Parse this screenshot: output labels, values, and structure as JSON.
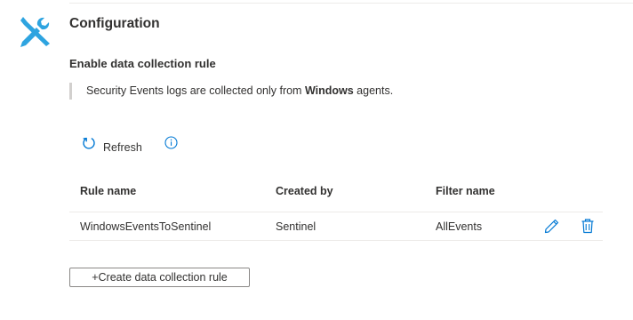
{
  "header": {
    "title": "Configuration",
    "subtitle": "Enable data collection rule",
    "note_prefix": "Security Events logs are collected only from ",
    "note_emphasis": "Windows",
    "note_suffix": " agents."
  },
  "toolbar": {
    "refresh_label": "Refresh"
  },
  "table": {
    "columns": [
      "Rule name",
      "Created by",
      "Filter name"
    ],
    "rows": [
      {
        "rule_name": "WindowsEventsToSentinel",
        "created_by": "Sentinel",
        "filter_name": "AllEvents"
      }
    ]
  },
  "actions": {
    "create_label": "+Create data collection rule"
  },
  "colors": {
    "accent": "#0078d4",
    "icon_blue": "#2ea4e0",
    "text": "#323130",
    "border": "#8a8886"
  },
  "icons": [
    "tools-icon",
    "refresh-icon",
    "info-icon",
    "edit-icon",
    "delete-icon"
  ]
}
